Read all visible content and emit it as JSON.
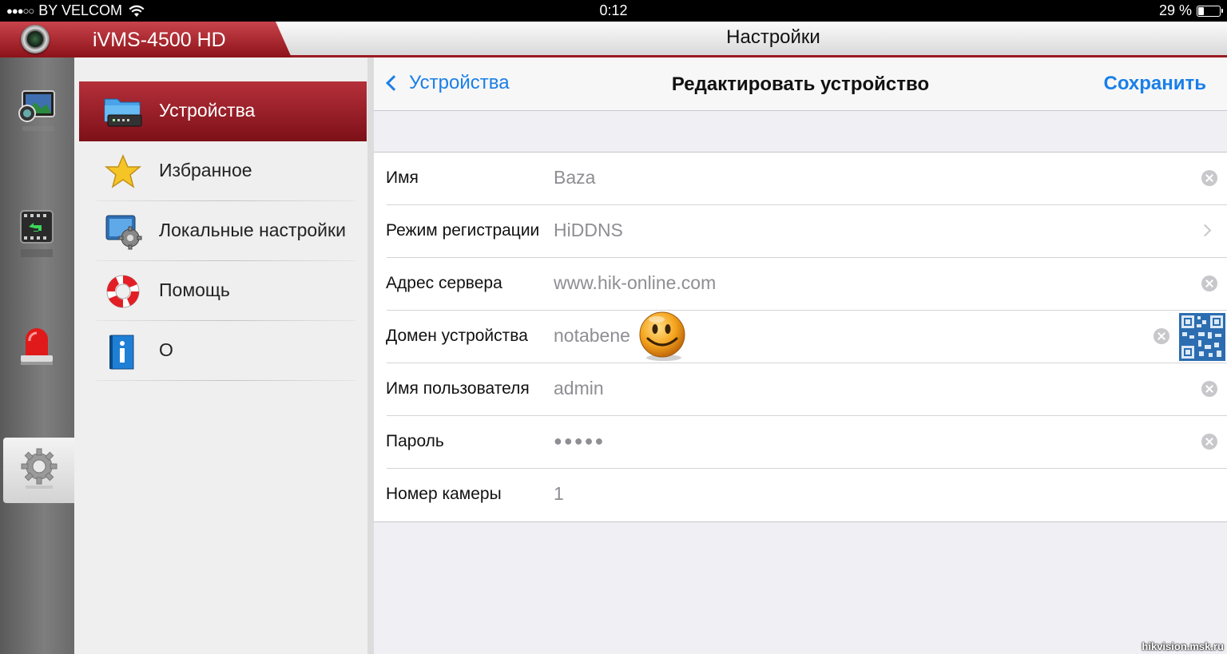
{
  "status_bar": {
    "signal_dots": "●●●○○",
    "carrier": "BY VELCOM",
    "wifi_icon": "wifi-icon",
    "time": "0:12",
    "battery_text": "29 %",
    "battery_level": 0.29
  },
  "app_header": {
    "app_name": "iVMS-4500 HD",
    "title": "Настройки",
    "brand_color": "#9c1b22"
  },
  "sidebar_icons": [
    "media-icon",
    "playback-icon",
    "alarm-icon",
    "settings-gear-icon"
  ],
  "menu": {
    "items": [
      {
        "label": "Устройства",
        "icon": "devices-folder-icon",
        "active": true
      },
      {
        "label": "Избранное",
        "icon": "star-icon",
        "active": false
      },
      {
        "label": "Локальные настройки",
        "icon": "local-settings-icon",
        "active": false
      },
      {
        "label": "Помощь",
        "icon": "lifebuoy-icon",
        "active": false
      },
      {
        "label": "О",
        "icon": "info-icon",
        "active": false
      }
    ]
  },
  "detail": {
    "back_label": "Устройства",
    "title": "Редактировать устройство",
    "save_label": "Сохранить",
    "accent_color": "#1a7fe8",
    "fields": [
      {
        "label": "Имя",
        "value": "Baza",
        "control": "clear"
      },
      {
        "label": "Режим регистрации",
        "value": "HiDDNS",
        "control": "disclosure"
      },
      {
        "label": "Адрес сервера",
        "value": "www.hik-online.com",
        "control": "clear"
      },
      {
        "label": "Домен устройства",
        "value": "notabene",
        "control": "clear+qr"
      },
      {
        "label": "Имя пользователя",
        "value": "admin",
        "control": "clear"
      },
      {
        "label": "Пароль",
        "value": "●●●●●",
        "control": "clear"
      },
      {
        "label": "Номер камеры",
        "value": "1",
        "control": "none"
      }
    ]
  },
  "watermark": "hikvision.msk.ru"
}
